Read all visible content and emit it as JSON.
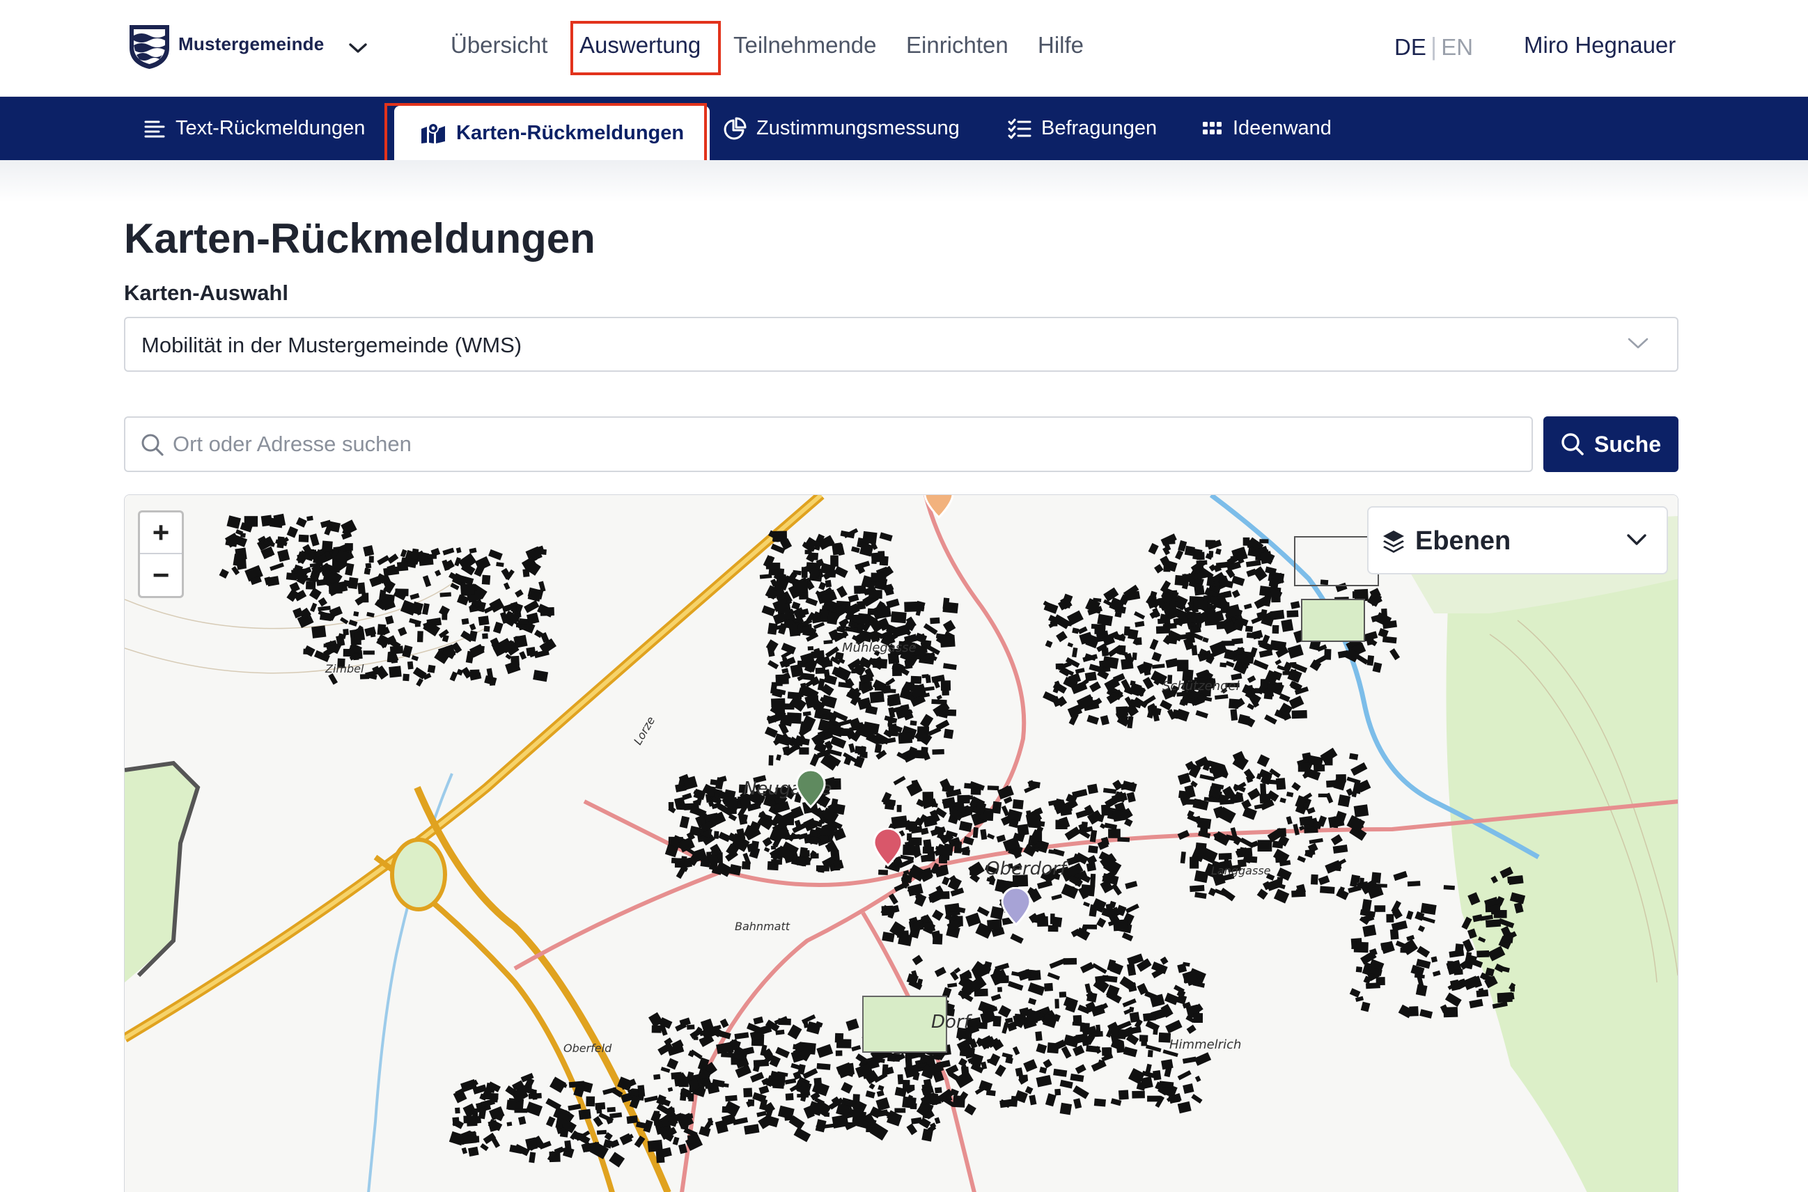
{
  "brand": {
    "name": "Mustergemeinde"
  },
  "main_nav": [
    {
      "label": "Übersicht"
    },
    {
      "label": "Auswertung"
    },
    {
      "label": "Teilnehmende"
    },
    {
      "label": "Einrichten"
    },
    {
      "label": "Hilfe"
    }
  ],
  "language": {
    "active": "DE",
    "other": "EN"
  },
  "user": {
    "name": "Miro Hegnauer"
  },
  "sub_nav": [
    {
      "label": "Text-Rückmeldungen",
      "icon": "text-lines-icon"
    },
    {
      "label": "Karten-Rückmeldungen",
      "icon": "map-pin-icon"
    },
    {
      "label": "Zustimmungsmessung",
      "icon": "pie-chart-icon"
    },
    {
      "label": "Befragungen",
      "icon": "checklist-icon"
    },
    {
      "label": "Ideenwand",
      "icon": "grid-icon"
    }
  ],
  "page": {
    "title": "Karten-Rückmeldungen",
    "map_select_label": "Karten-Auswahl",
    "map_select_value": "Mobilität in der Mustergemeinde (WMS)"
  },
  "search": {
    "placeholder": "Ort oder Adresse suchen",
    "button_label": "Suche"
  },
  "map": {
    "zoom_in": "+",
    "zoom_out": "−",
    "layers_label": "Ebenen",
    "place_labels": [
      "Neugasse",
      "Oberdorf",
      "Dorf",
      "Mühlegasse",
      "Himmelrich",
      "Schützengel",
      "Zimbel",
      "Oberfeld",
      "Langgasse",
      "Lorze",
      "Bahnmatt"
    ],
    "pins": [
      {
        "color": "#5f8a5f"
      },
      {
        "color": "#d9576a"
      },
      {
        "color": "#a7a3d6"
      },
      {
        "color": "#f2b27d"
      }
    ]
  },
  "colors": {
    "navy": "#0c2166",
    "highlight": "#e2331c"
  }
}
